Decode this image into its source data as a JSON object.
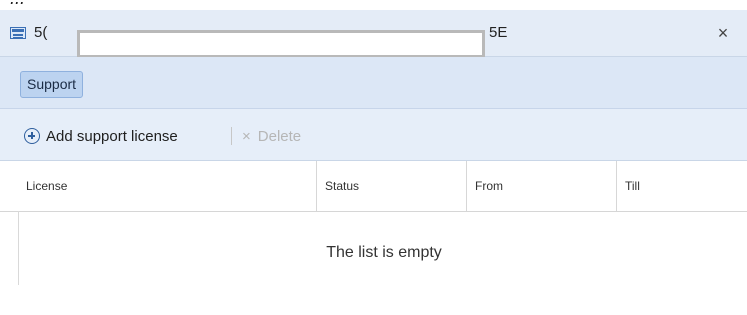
{
  "top_strip": {
    "text": "..."
  },
  "window": {
    "title_left": "5(",
    "title_right": "5E",
    "close_glyph": "×",
    "icon": "window-icon",
    "close_icon": "close-icon"
  },
  "tabs": [
    {
      "label": "Support",
      "active": true
    }
  ],
  "toolbar": {
    "add_label": "Add support license",
    "add_icon": "plus-circle-icon",
    "delete_label": "Delete",
    "delete_glyph": "×",
    "delete_icon": "delete-icon",
    "delete_disabled": true
  },
  "table": {
    "columns": [
      "License",
      "Status",
      "From",
      "Till"
    ],
    "empty_text": "The list is empty"
  },
  "colors": {
    "titlebar_bg": "#e4ecf7",
    "tabrow_bg": "#dce7f6",
    "tab_active_bg": "#bcd3f0",
    "toolbar_bg": "#e6eef9",
    "accent": "#2f5f9e",
    "disabled_text": "#b6b6b6"
  }
}
